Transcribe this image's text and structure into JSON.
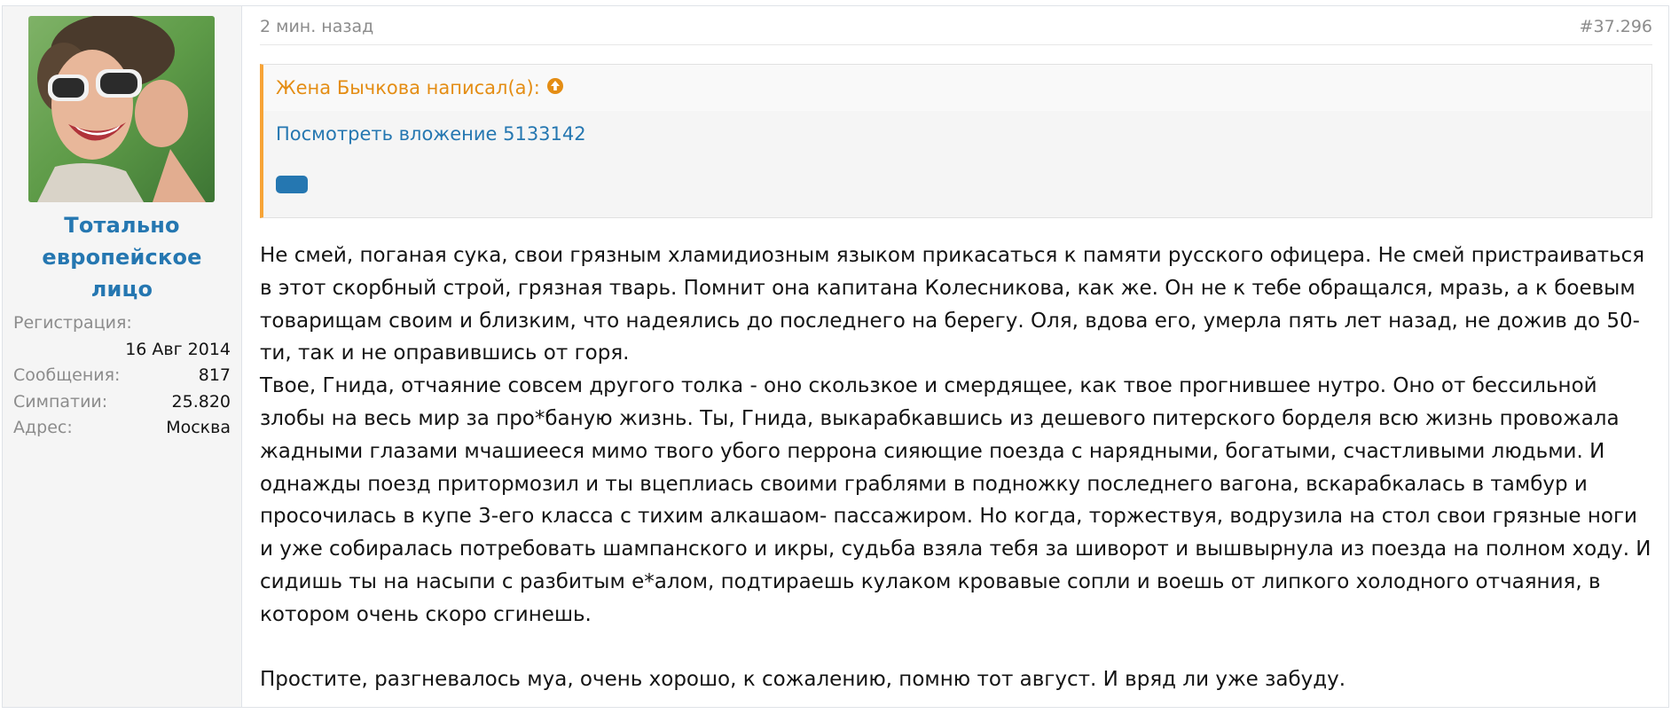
{
  "user": {
    "name_line1": "Тотально",
    "name_line2": "европейское лицо",
    "stats": {
      "registration_label": "Регистрация:",
      "registration_value": "16 Авг 2014",
      "messages_label": "Сообщения:",
      "messages_value": "817",
      "likes_label": "Симпатии:",
      "likes_value": "25.820",
      "address_label": "Адрес:",
      "address_value": "Москва"
    }
  },
  "post": {
    "time": "2 мин. назад",
    "number": "#37.296",
    "quote": {
      "author_text": "Жена Бычкова написал(а):",
      "attachment_link": "Посмотреть вложение 5133142"
    },
    "paragraphs": [
      "Не смей, поганая сука, свои грязным хламидиозным языком прикасаться к памяти русского офицера. Не смей пристраиваться в этот скорбный строй, грязная тварь. Помнит она капитана Колесникова, как же. Он не к тебе обращался, мразь, а к боевым товарищам своим и близким, что надеялись до последнего на берегу. Оля, вдова его, умерла пять лет назад, не дожив до 50-ти, так и не оправившись от горя.",
      "Твое, Гнида, отчаяние совсем другого толка - оно скользкое и смердящее, как твое прогнившее нутро. Оно от бессильной злобы на весь мир за про*баную жизнь. Ты, Гнида, выкарабкавшись из дешевого питерского борделя всю жизнь провожала жадными глазами мчашиееся мимо твого убого перрона сияющие поезда с нарядными, богатыми, счастливыми людьми. И однажды поезд притормозил и ты вцеплиась своими граблями в подножку последнего вагона, вскарабкалась в тамбур и просочилась в купе 3-его класса с тихим алкашаом- пассажиром. Но когда, торжествуя, водрузила на стол свои грязные ноги и уже собиралась потребовать шампанского и икры, судьба взяла тебя за шиворот и вышвырнула из поезда на полном ходу. И сидишь ты на насыпи с разбитым е*алом, подтираешь кулаком кровавые сопли и воешь от липкого холодного отчаяния, в котором очень скоро сгинешь.",
      "Простите, разгневалось муа, очень хорошо, к сожалению, помню тот август. И вряд ли уже забуду."
    ]
  }
}
